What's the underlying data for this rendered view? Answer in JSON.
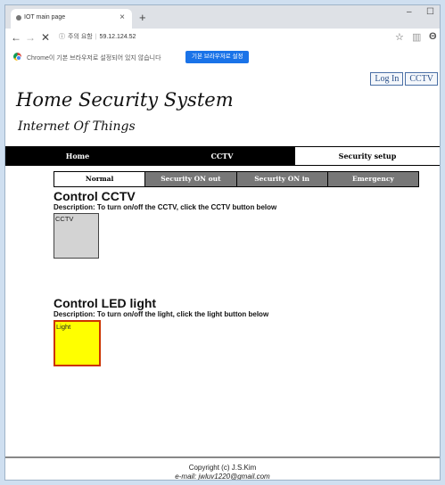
{
  "browser": {
    "tab_title": "IOT main page",
    "tab_close": "×",
    "new_tab": "+",
    "minimize": "–",
    "maximize": "☐",
    "back": "←",
    "forward": "→",
    "stop": "✕",
    "info_icon": "ⓘ",
    "security_label": "주의 요함",
    "address": "59.12.124.52",
    "star": "☆",
    "ext": "▥",
    "account": "Θ",
    "infobar_message": "Chrome이 기본 브라우저로 설정되어 있지 않습니다",
    "infobar_button": "기본 브라우저로 설정"
  },
  "page": {
    "top_buttons": [
      "Log In",
      "CCTV"
    ],
    "title": "Home Security System",
    "subtitle": "Internet Of Things",
    "main_nav": [
      {
        "label": "Home",
        "active": false
      },
      {
        "label": "CCTV",
        "active": false
      },
      {
        "label": "Security setup",
        "active": true
      }
    ],
    "sub_nav": [
      {
        "label": "Normal",
        "active": true
      },
      {
        "label": "Security ON out",
        "active": false
      },
      {
        "label": "Security ON in",
        "active": false
      },
      {
        "label": "Emergency",
        "active": false
      }
    ],
    "cctv_section": {
      "title": "Control CCTV",
      "description": "Description: To turn on/off the CCTV, click the CCTV button below",
      "button_label": "CCTV"
    },
    "light_section": {
      "title": "Control LED light",
      "description": "Description: To turn on/off the light, click the light button below",
      "button_label": "Light"
    },
    "footer": {
      "copyright": "Copyright (c) J.S.Kim",
      "email": "e-mail: jwluv1220@gmail.com"
    }
  },
  "colors": {
    "light_button": "#ffff00",
    "cctv_button": "#d3d3d3",
    "nav_active_bg": "#ffffff",
    "nav_bg": "#000000",
    "subnav_bg": "#777777"
  }
}
